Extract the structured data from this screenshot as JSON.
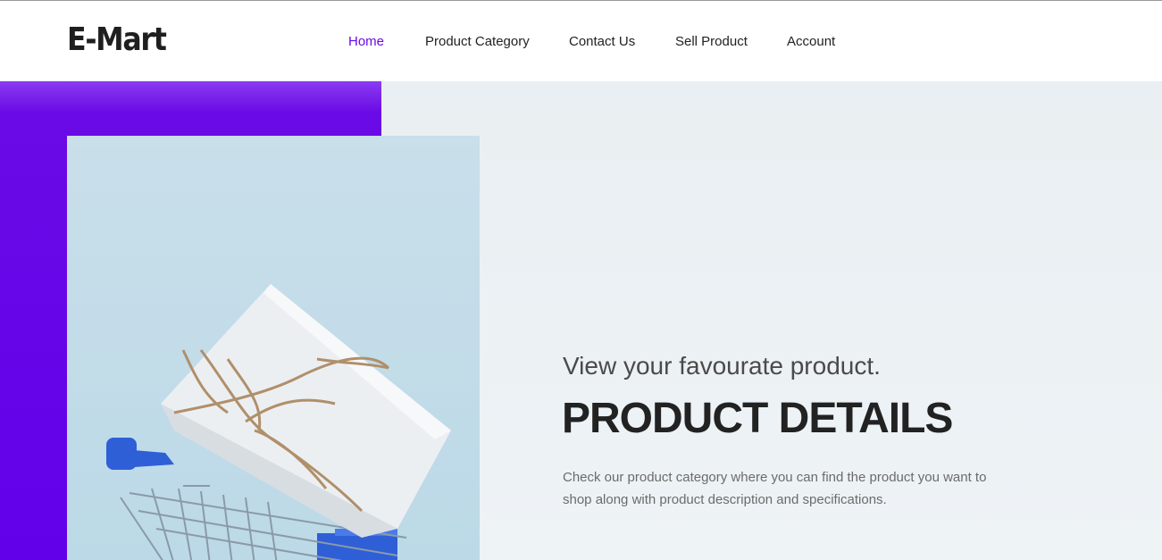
{
  "brand": {
    "logo_text": "E-Mart"
  },
  "nav": {
    "items": [
      {
        "label": "Home",
        "active": true
      },
      {
        "label": "Product Category",
        "active": false
      },
      {
        "label": "Contact Us",
        "active": false
      },
      {
        "label": "Sell Product",
        "active": false
      },
      {
        "label": "Account",
        "active": false
      }
    ]
  },
  "hero": {
    "subtitle": "View your favourate product.",
    "title": "PRODUCT DETAILS",
    "description": "Check our product category where you can find the product you want to shop along with product description and specifications.",
    "image_subject": "gift-box-in-shopping-cart"
  },
  "colors": {
    "accent": "#6200ea",
    "active_link": "#6b08e8",
    "hero_bg": "#eef3f6",
    "text_dark": "#222222"
  }
}
